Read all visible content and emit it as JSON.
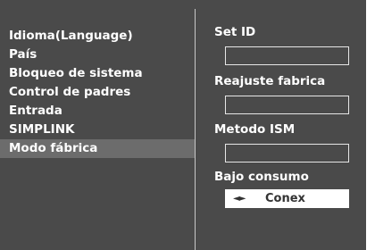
{
  "menu": {
    "items": [
      {
        "label": "Idioma(Language)"
      },
      {
        "label": "País"
      },
      {
        "label": "Bloqueo de sistema"
      },
      {
        "label": "Control de padres"
      },
      {
        "label": "Entrada"
      },
      {
        "label": "SIMPLINK"
      },
      {
        "label": "Modo fábrica",
        "selected": true
      }
    ]
  },
  "options": {
    "set_id": {
      "label": "Set ID",
      "value": ""
    },
    "reajuste": {
      "label": "Reajuste fabrica",
      "value": ""
    },
    "ism": {
      "label": "Metodo ISM",
      "value": ""
    },
    "bajo_consumo": {
      "label": "Bajo consumo",
      "value": "Conex",
      "arrows_glyph": "◄►"
    }
  },
  "colors": {
    "panel_bg": "#4a4a4a",
    "selected_bg": "#6c6c6c",
    "text": "#ffffff",
    "active_field_bg": "#ffffff",
    "divider": "#c8c8c8"
  }
}
